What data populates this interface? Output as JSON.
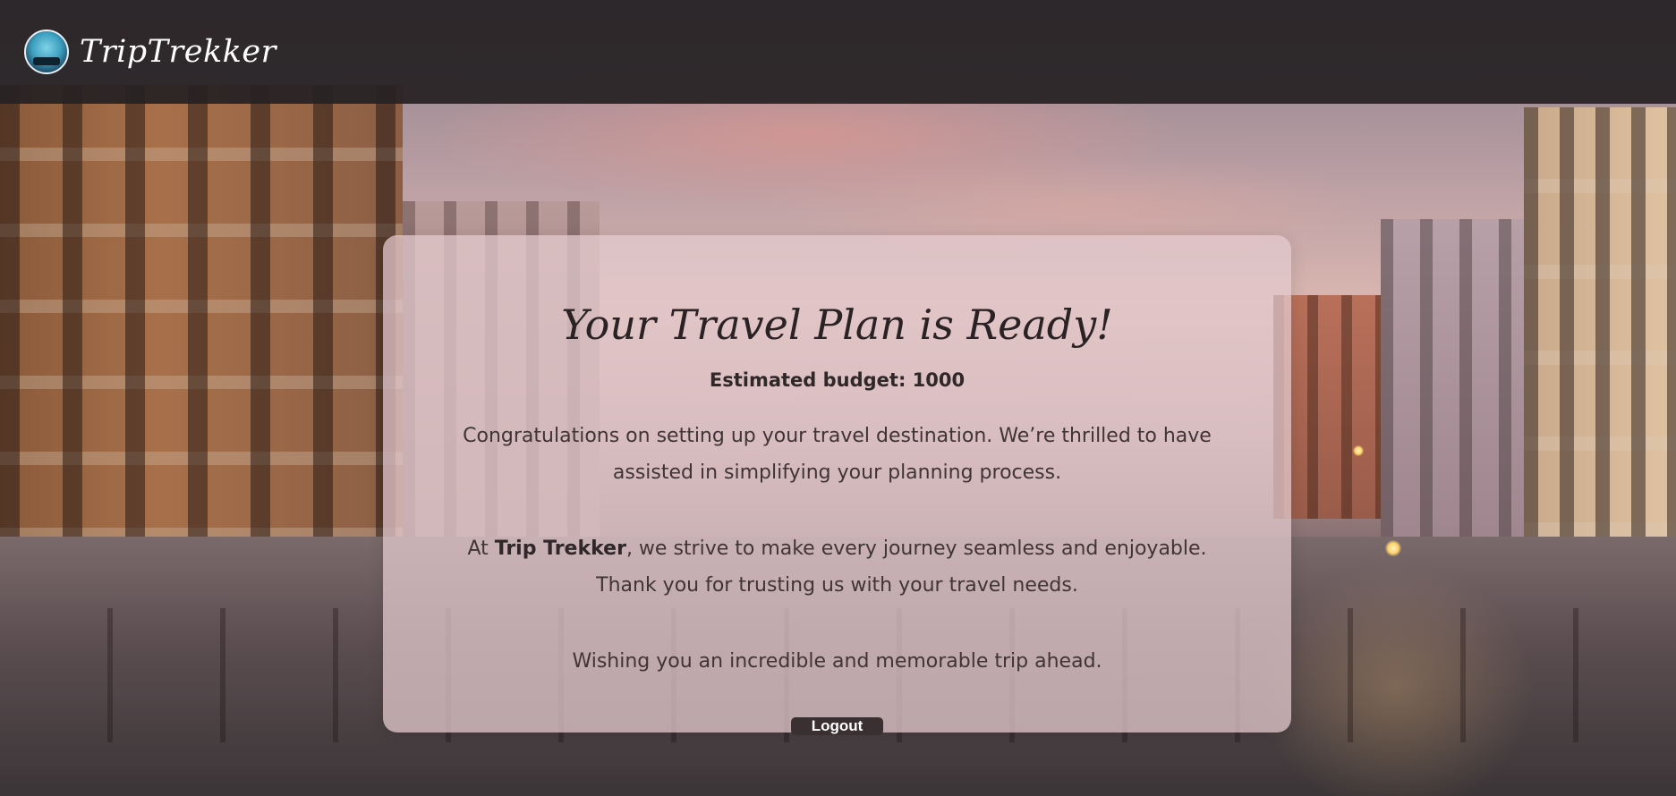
{
  "header": {
    "brand_name": "TripTrekker",
    "logo_icon": "trip-trekker-logo-icon"
  },
  "card": {
    "title": "Your Travel Plan is Ready!",
    "budget_label": "Estimated budget: 1000",
    "paragraph1": "Congratulations on setting up your travel destination. We’re thrilled to have assisted in simplifying your planning process.",
    "paragraph2_prefix": "At ",
    "paragraph2_brand": "Trip Trekker",
    "paragraph2_suffix": ", we strive to make every journey seamless and enjoyable. Thank you for trusting us with your travel needs.",
    "paragraph3": "Wishing you an incredible and memorable trip ahead.",
    "logout_label": "Logout"
  },
  "colors": {
    "header_bg": "#262124",
    "card_bg": "#e4cbce",
    "button_bg": "#3a2f31",
    "text": "#3f3436"
  }
}
